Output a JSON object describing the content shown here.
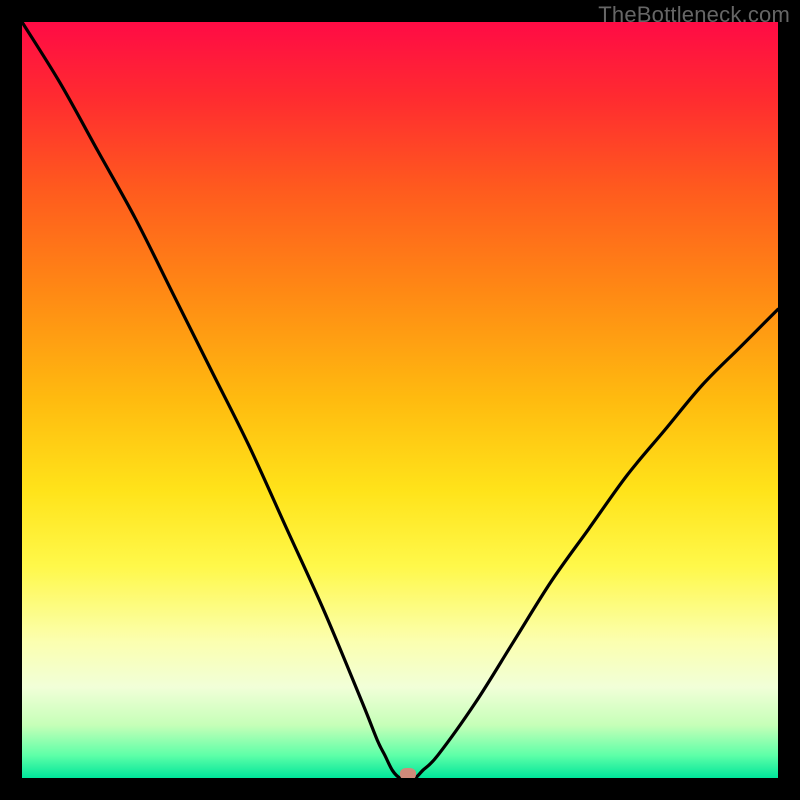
{
  "watermark": "TheBottleneck.com",
  "colors": {
    "frame": "#000000",
    "gradient_top": "#ff0b45",
    "gradient_bottom": "#00e59a",
    "curve": "#000000",
    "marker": "#d08a7a",
    "watermark_text": "#666666"
  },
  "chart_data": {
    "type": "line",
    "title": "",
    "xlabel": "",
    "ylabel": "",
    "xlim": [
      0,
      100
    ],
    "ylim": [
      0,
      100
    ],
    "grid": false,
    "legend": null,
    "series": [
      {
        "name": "bottleneck-curve",
        "x": [
          0,
          5,
          10,
          15,
          20,
          25,
          30,
          35,
          40,
          45,
          47,
          48,
          49,
          50,
          51,
          52,
          53,
          55,
          60,
          65,
          70,
          75,
          80,
          85,
          90,
          95,
          100
        ],
        "values": [
          100,
          92,
          83,
          74,
          64,
          54,
          44,
          33,
          22,
          10,
          5,
          3,
          1,
          0,
          0,
          0,
          1,
          3,
          10,
          18,
          26,
          33,
          40,
          46,
          52,
          57,
          62
        ]
      }
    ],
    "annotations": [
      {
        "name": "minimum-marker",
        "x": 51,
        "y": 0
      }
    ],
    "background_gradient": {
      "direction": "top-to-bottom",
      "stops": [
        {
          "pos": 0,
          "color": "#ff0b45"
        },
        {
          "pos": 50,
          "color": "#ffbb0f"
        },
        {
          "pos": 82,
          "color": "#fbffb0"
        },
        {
          "pos": 100,
          "color": "#00e59a"
        }
      ]
    }
  }
}
